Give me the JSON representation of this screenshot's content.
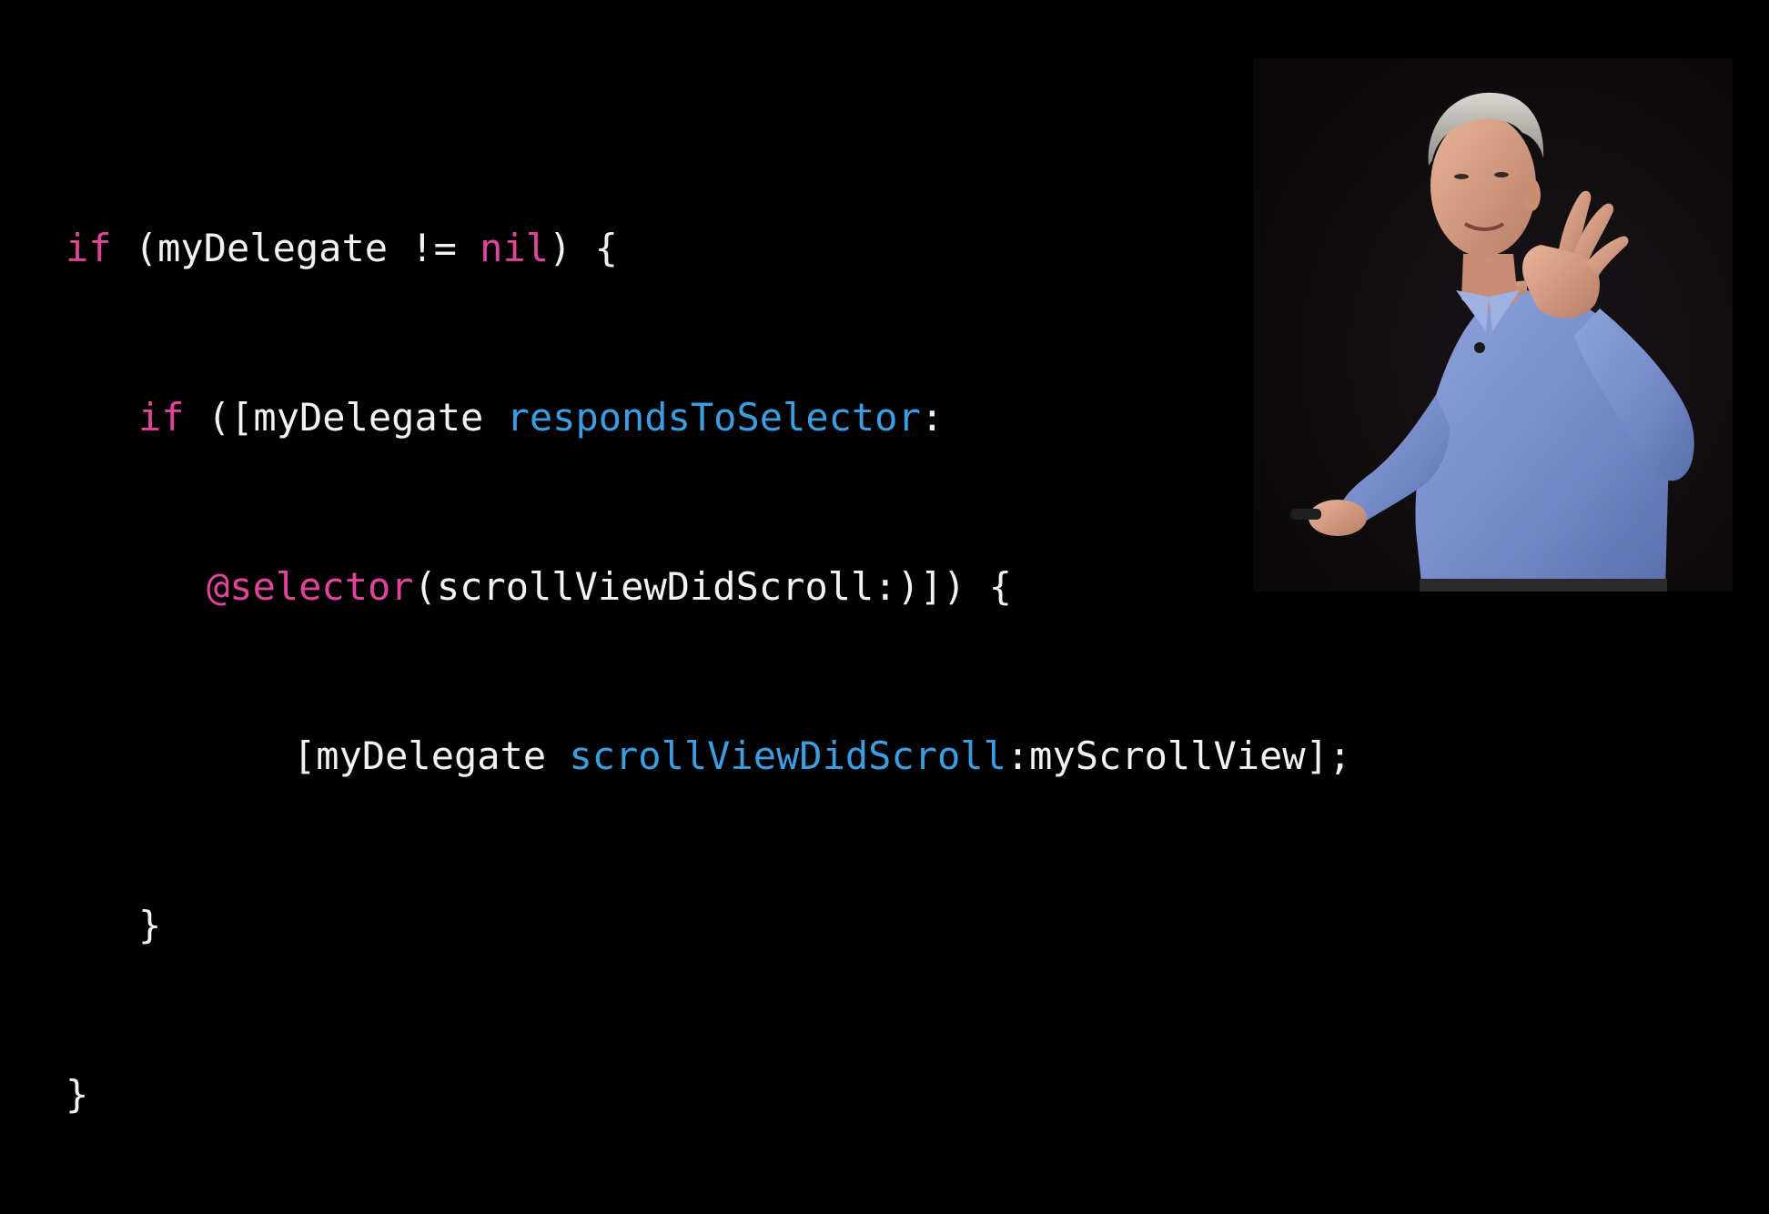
{
  "code": {
    "line1": {
      "kw_if": "if",
      "text_a": " (myDelegate != ",
      "kw_nil": "nil",
      "text_b": ") {"
    },
    "line2": {
      "kw_if": "if",
      "text_a": " ([myDelegate ",
      "msg": "respondsToSelector",
      "text_b": ":"
    },
    "line3": {
      "kw_selector": "@selector",
      "text_a": "(scrollViewDidScroll:)]) {"
    },
    "line4": {
      "text_a": "[myDelegate ",
      "msg": "scrollViewDidScroll",
      "text_b": ":myScrollView];"
    },
    "line5": {
      "text_a": "}"
    },
    "line6": {
      "text_a": "}"
    }
  },
  "colors": {
    "background": "#000000",
    "keyword": "#e0449a",
    "message": "#3c9ee0",
    "text": "#f2f2f2",
    "shirt": "#7e93cf"
  },
  "video": {
    "subject": "presenter-speaking"
  }
}
